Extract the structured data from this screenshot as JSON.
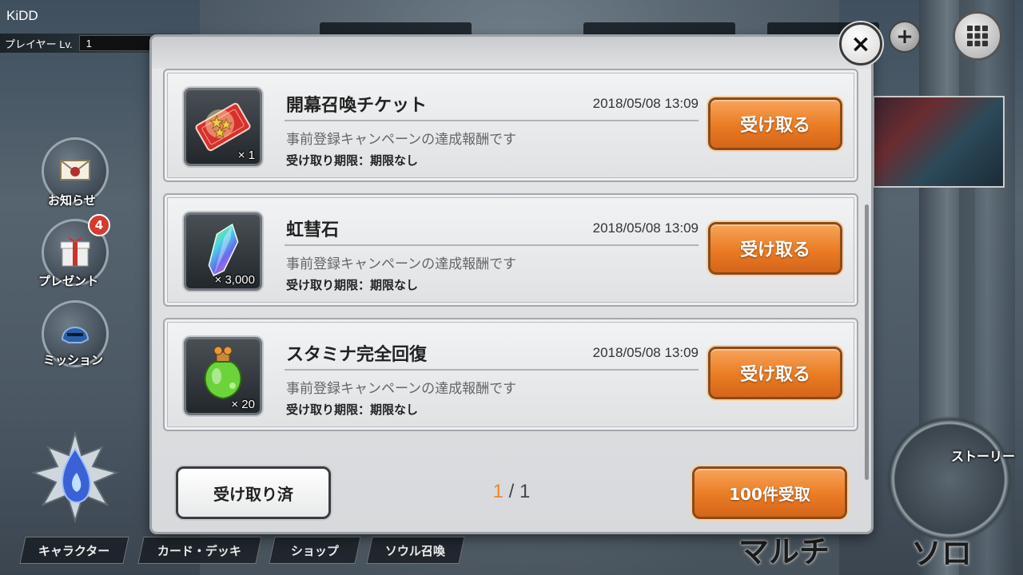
{
  "hud": {
    "player_name": "KiDD",
    "level_label": "プレイヤー Lv.",
    "level_value": "1"
  },
  "side_menu": {
    "notice_label": "お知らせ",
    "present_label": "プレゼント",
    "present_badge": "4",
    "mission_label": "ミッション"
  },
  "bottom_tabs": [
    "キャラクター",
    "カード・デッキ",
    "ショップ",
    "ソウル召喚"
  ],
  "modes": {
    "multi_label": "マルチ",
    "solo_label": "ソロ",
    "story_label": "ストーリー"
  },
  "modal": {
    "close_icon": "×",
    "items": [
      {
        "name": "開幕召喚チケット",
        "date": "2018/05/08 13:09",
        "description": "事前登録キャンペーンの達成報酬です",
        "limit": "受け取り期限：期限なし",
        "quantity": "× 1",
        "icon": "summon-ticket-icon",
        "button_label": "受け取る"
      },
      {
        "name": "虹彗石",
        "date": "2018/05/08 13:09",
        "description": "事前登録キャンペーンの達成報酬です",
        "limit": "受け取り期限：期限なし",
        "quantity": "× 3,000",
        "icon": "rainbow-crystal-icon",
        "button_label": "受け取る"
      },
      {
        "name": "スタミナ完全回復",
        "date": "2018/05/08 13:09",
        "description": "事前登録キャンペーンの達成報酬です",
        "limit": "受け取り期限：期限なし",
        "quantity": "× 20",
        "icon": "stamina-potion-icon",
        "button_label": "受け取る"
      }
    ],
    "received_button_label": "受け取り済",
    "page_current": "1",
    "page_separator": " / ",
    "page_total": "1",
    "bulk_button_label": "100件受取"
  },
  "colors": {
    "accent_orange": "#ea7b23",
    "page_current": "#e88a2c",
    "badge_red": "#d63a2e"
  }
}
